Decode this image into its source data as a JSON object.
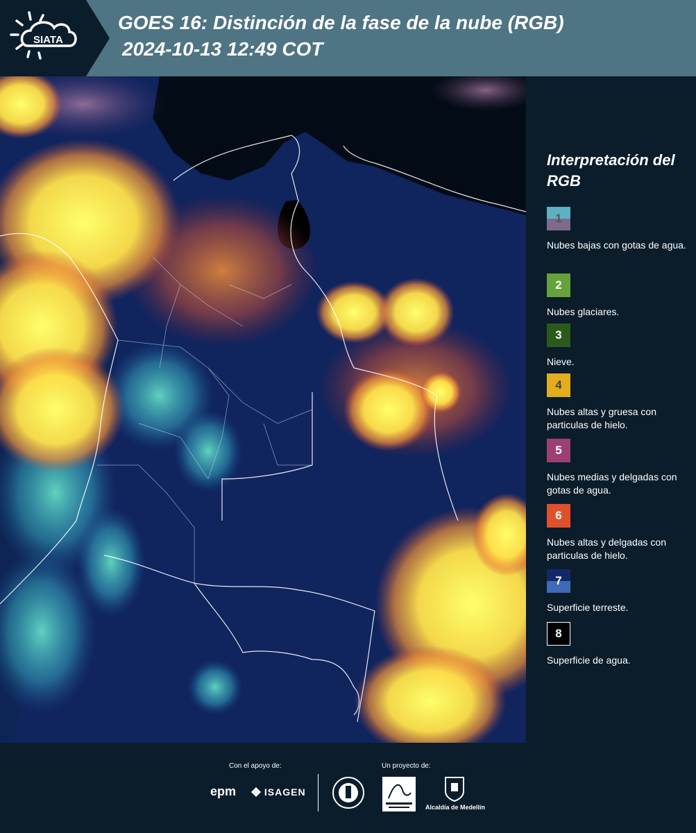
{
  "header": {
    "logo_text": "SIATA",
    "title": "GOES 16: Distinción de la fase de la nube (RGB)",
    "timestamp": "2024-10-13 12:49 COT"
  },
  "legend": {
    "title": "Interpretación del RGB",
    "items": [
      {
        "number": "1",
        "label": "Nubes bajas con gotas de agua.",
        "color_top": "#5fb0c0",
        "color_bottom": "#7d6b8e",
        "text_color": "#555555"
      },
      {
        "number": "2",
        "label": "Nubes glaciares.",
        "color": "#65a23a",
        "text_color": "#ffffff"
      },
      {
        "number": "3",
        "label": "Nieve.",
        "color": "#2b5a1c",
        "text_color": "#ffffff"
      },
      {
        "number": "4",
        "label": "Nubes altas y gruesa con particulas de hielo.",
        "color": "#e3ad1c",
        "text_color": "#444444"
      },
      {
        "number": "5",
        "label": "Nubes medias y delgadas con gotas de agua.",
        "color": "#9c3f74",
        "text_color": "#ffffff"
      },
      {
        "number": "6",
        "label": "Nubes altas y delgadas con particulas de hielo.",
        "color": "#e0512b",
        "text_color": "#ffffff"
      },
      {
        "number": "7",
        "label": "Superficie terreste.",
        "color_top": "#142868",
        "color_bottom": "#3e6ab8",
        "text_color": "#ffffff"
      },
      {
        "number": "8",
        "label": "Superficie de agua.",
        "color": "#000000",
        "text_color": "#ffffff"
      }
    ]
  },
  "footer": {
    "support_label": "Con el apoyo de:",
    "project_label": "Un proyecto de:",
    "sponsor_1": "epm",
    "sponsor_2": "ISAGEN",
    "partner_3": "Alcaldía de Medellín"
  },
  "colors": {
    "header_bg": "#4f7483",
    "panel_bg": "#0b1d2b",
    "land": "#13286a",
    "cloud_yellow": "#ffee55",
    "cloud_orange": "#e0702f"
  }
}
